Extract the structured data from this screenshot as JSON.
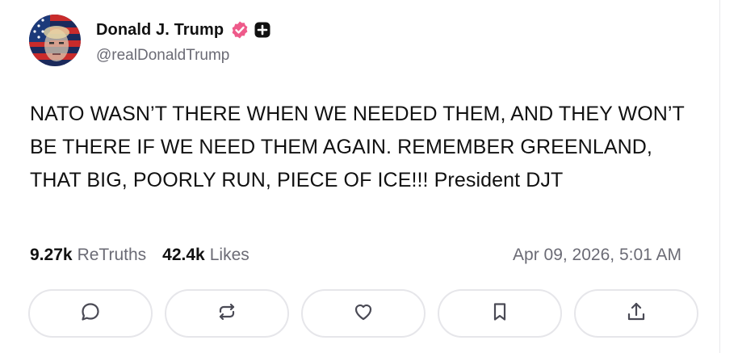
{
  "author": {
    "display_name": "Donald J. Trump",
    "handle": "@realDonaldTrump",
    "verified_icon": "verified-badge-icon",
    "plus_icon": "plus-badge-icon",
    "verified_color": "#ee5a8a"
  },
  "post": {
    "text": "NATO WASN’T THERE WHEN WE NEEDED THEM, AND THEY WON’T BE THERE IF WE NEED THEM AGAIN. REMEMBER GREENLAND, THAT BIG, POORLY RUN, PIECE OF ICE!!! President DJT"
  },
  "stats": {
    "retruths_count": "9.27k",
    "retruths_label": "ReTruths",
    "likes_count": "42.4k",
    "likes_label": "Likes",
    "timestamp": "Apr 09, 2026, 5:01 AM"
  },
  "actions": [
    {
      "icon": "reply-icon"
    },
    {
      "icon": "retruth-icon"
    },
    {
      "icon": "like-icon"
    },
    {
      "icon": "bookmark-icon"
    },
    {
      "icon": "share-icon"
    }
  ]
}
